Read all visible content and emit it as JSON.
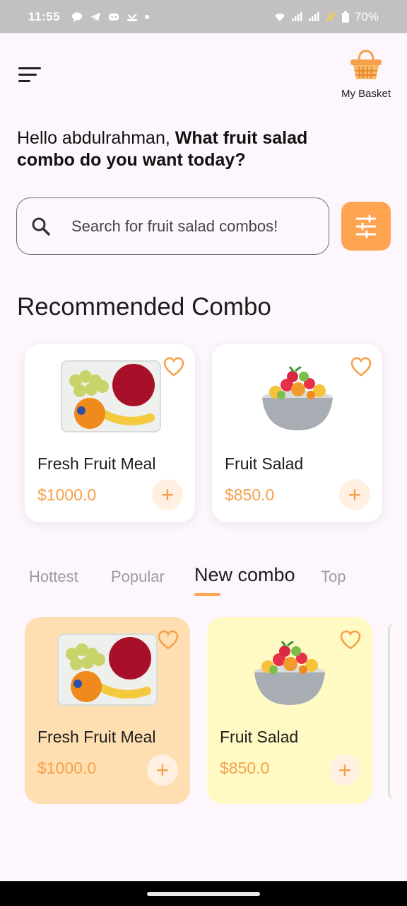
{
  "status_bar": {
    "time": "11:55",
    "battery": "70%"
  },
  "header": {
    "basket_label": "My Basket"
  },
  "greeting": {
    "plain": "Hello abdulrahman,",
    "bold": " What fruit salad combo do you want today?"
  },
  "search": {
    "placeholder": "Search for fruit salad combos!"
  },
  "recommended": {
    "title": "Recommended Combo",
    "items": [
      {
        "name": "Fresh Fruit Meal",
        "price": "$1000.0"
      },
      {
        "name": "Fruit Salad",
        "price": "$850.0"
      }
    ]
  },
  "tabs": [
    {
      "label": "Hottest",
      "active": false
    },
    {
      "label": "Popular",
      "active": false
    },
    {
      "label": "New combo",
      "active": true
    },
    {
      "label": "Top",
      "active": false
    }
  ],
  "combos": [
    {
      "name": "Fresh Fruit Meal",
      "price": "$1000.0",
      "bg_color": "#ffdfb1"
    },
    {
      "name": "Fruit Salad",
      "price": "$850.0",
      "bg_color": "#fffac4"
    }
  ],
  "colors": {
    "accent": "#ffa451",
    "price": "#f5a14b"
  }
}
